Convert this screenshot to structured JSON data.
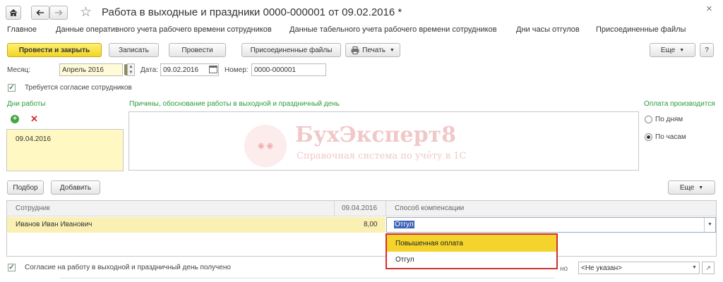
{
  "window": {
    "title": "Работа в выходные и праздники 0000-000001 от 09.02.2016 *",
    "close": "×"
  },
  "tabs": [
    "Главное",
    "Данные оперативного учета рабочего времени сотрудников",
    "Данные табельного учета рабочего времени сотрудников",
    "Дни часы отгулов",
    "Присоединенные файлы"
  ],
  "toolbar": {
    "post_close": "Провести и закрыть",
    "save": "Записать",
    "post": "Провести",
    "attached": "Присоединенные файлы",
    "print": "Печать",
    "more": "Еще",
    "help": "?"
  },
  "header_fields": {
    "month_label": "Месяц:",
    "month_value": "Апрель 2016",
    "date_label": "Дата:",
    "date_value": "09.02.2016",
    "number_label": "Номер:",
    "number_value": "0000-000001"
  },
  "consent_required": {
    "label": "Требуется согласие сотрудников",
    "checked": true
  },
  "workdays": {
    "title": "Дни работы",
    "items": [
      "09.04.2016"
    ]
  },
  "reasons": {
    "title": "Причины, обоснование работы в выходной и праздничный день",
    "value": ""
  },
  "payment": {
    "title": "Оплата производится",
    "options": [
      {
        "label": "По дням",
        "selected": false
      },
      {
        "label": "По часам",
        "selected": true
      }
    ]
  },
  "watermark": {
    "brand": "БухЭксперт8",
    "tagline": "Справочная система по учёту в 1С"
  },
  "table_toolbar": {
    "select": "Подбор",
    "add": "Добавить",
    "more": "Еще"
  },
  "table": {
    "columns": [
      "Сотрудник",
      "09.04.2016",
      "Способ компенсации"
    ],
    "rows": [
      {
        "employee": "Иванов Иван Иванович",
        "hours": "8,00",
        "compensation": "Отгул"
      }
    ]
  },
  "dropdown": {
    "options": [
      "Повышенная оплата",
      "Отгул"
    ],
    "highlighted": 0
  },
  "footer": {
    "consent_label": "Согласие на работу в выходной и праздничный день получено",
    "partial_label": "но",
    "select_value": "<Не указан>"
  },
  "colors": {
    "accent_green": "#2a9d3b",
    "primary_yellow": "#f1d428",
    "highlight_red": "#d32f2f",
    "selection_blue": "#3f63b8"
  }
}
